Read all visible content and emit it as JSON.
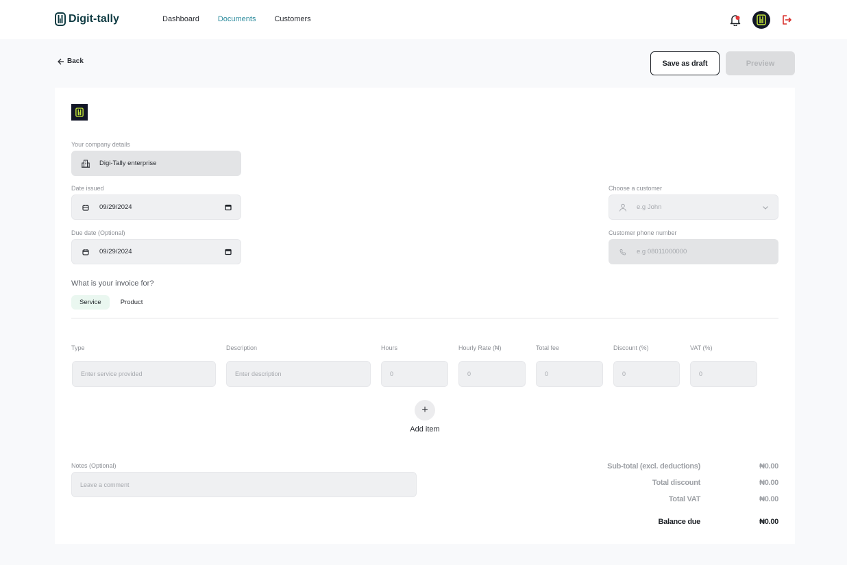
{
  "app": {
    "brand": "Digit-tally",
    "nav": [
      {
        "label": "Dashboard",
        "active": false
      },
      {
        "label": "Documents",
        "active": true
      },
      {
        "label": "Customers",
        "active": false
      }
    ],
    "icons": {
      "notifications": "bell-icon",
      "avatar": "company-avatar",
      "logout": "logout-icon"
    },
    "colors": {
      "accent": "#2a8a9c",
      "brand_dark": "#121627",
      "brand_lime": "#c6e93a",
      "logout_red": "#d9302c",
      "notification_dot": "#e5393a"
    }
  },
  "toolbar": {
    "back_label": "Back",
    "save_draft_label": "Save as draft",
    "preview_label": "Preview"
  },
  "form": {
    "company_label": "Your company details",
    "company_value": "Digi-Tally enterprise",
    "date_issued_label": "Date issued",
    "date_issued_value": "09/29/2024",
    "due_date_label": "Due date (Optional)",
    "due_date_value": "09/29/2024",
    "customer_label": "Choose a customer",
    "customer_placeholder": "e.g John",
    "phone_label": "Customer phone number",
    "phone_placeholder": "e.g 08011000000",
    "question": "What is your invoice for?",
    "types": [
      {
        "label": "Service",
        "active": true
      },
      {
        "label": "Product",
        "active": false
      }
    ]
  },
  "items": {
    "columns": [
      "Type",
      "Description",
      "Hours",
      "Hourly Rate (₦)",
      "Total fee",
      "Discount (%)",
      "VAT (%)"
    ],
    "row": [
      "Enter service provided",
      "Enter description",
      "0",
      "0",
      "0",
      "0",
      "0"
    ],
    "add_label": "Add item",
    "add_symbol": "+"
  },
  "notes": {
    "label": "Notes (Optional)",
    "placeholder": "Leave a comment"
  },
  "summary": [
    {
      "label": "Sub-total (excl. deductions)",
      "value": "₦0.00"
    },
    {
      "label": "Total discount",
      "value": "₦0.00"
    },
    {
      "label": "Total VAT",
      "value": "₦0.00"
    },
    {
      "label": "Balance due",
      "value": "₦0.00"
    }
  ]
}
